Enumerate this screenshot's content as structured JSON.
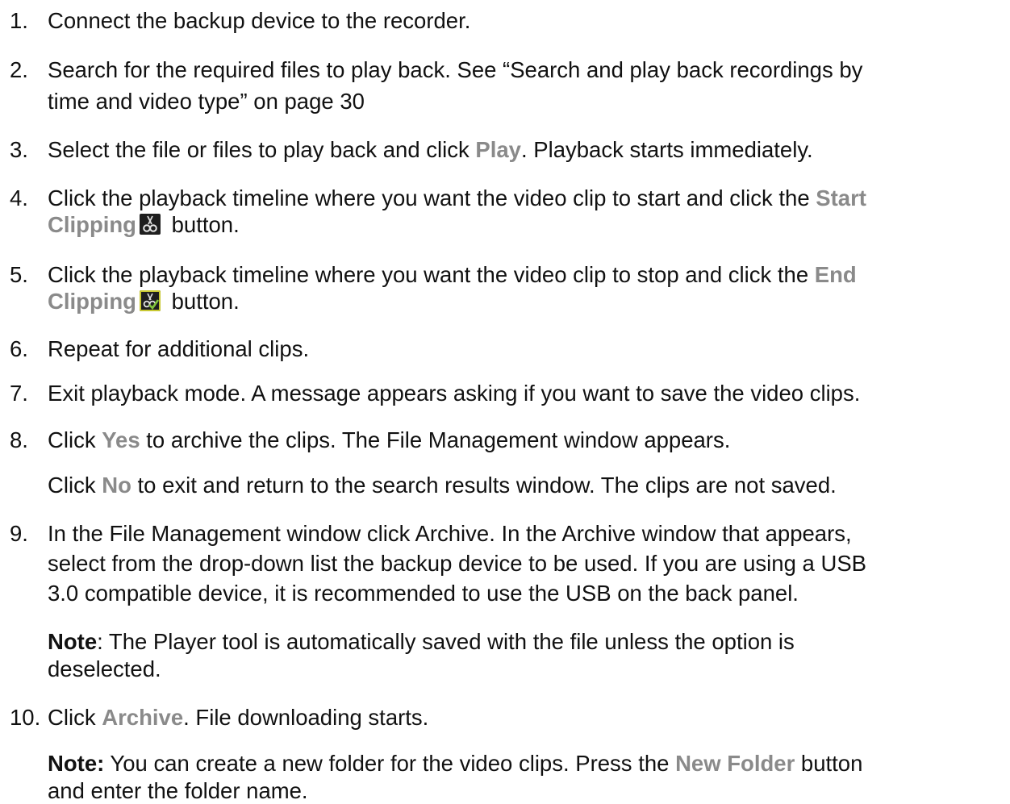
{
  "steps": [
    {
      "num": "1.",
      "text": "Connect the backup device to the recorder."
    },
    {
      "num": "2.",
      "line1": "Search for the required files to play back. See “Search and play back recordings by",
      "line2": "time and video type” on page 30"
    },
    {
      "num": "3.",
      "pre": "Select the file or files to play back and click ",
      "hl": "Play",
      "post": ". Playback starts immediately."
    },
    {
      "num": "4.",
      "line1_pre": "Click the playback timeline where you want the video clip to start and click the ",
      "line1_hl": "Start",
      "line2_hl": "Clipping",
      "line2_post": " button."
    },
    {
      "num": "5.",
      "line1_pre": "Click the playback timeline where you want the video clip to stop and click the ",
      "line1_hl": "End",
      "line2_hl": "Clipping",
      "line2_post": " button."
    },
    {
      "num": "6.",
      "text": "Repeat for additional clips."
    },
    {
      "num": "7.",
      "text": "Exit playback mode. A message appears asking if you want to save the video clips."
    },
    {
      "num": "8.",
      "pre": "Click ",
      "hl": "Yes",
      "post": " to archive the clips. The File Management window appears.",
      "sub_pre": "Click ",
      "sub_hl": "No",
      "sub_post": " to exit and return to the search results window. The clips are not saved."
    },
    {
      "num": "9.",
      "line1": "In the File Management window click Archive.  In the Archive window that appears,",
      "line2": "select from the drop-down list the backup device to be used. If you are using a USB",
      "line3": "3.0 compatible device, it is recommended to use the USB on the back panel.",
      "note_label": "Note",
      "note_line1": ": The Player tool is automatically saved with the file unless the option is",
      "note_line2": "deselected."
    },
    {
      "num": "10.",
      "pre": "Click ",
      "hl": "Archive",
      "post": ". File downloading starts.",
      "note_label": "Note:",
      "note_pre": " You can create a new folder for the video clips. Press the ",
      "note_hl": "New Folder",
      "note_post": " button",
      "note_line2": "and enter the folder name."
    }
  ],
  "icons": {
    "start_clipping": "scissors-icon",
    "end_clipping": "scissors-check-icon",
    "colors": {
      "text": "#111111",
      "highlight": "#8a8a8a",
      "icon_bg": "#1e1e1e",
      "icon_border": "#c8c832",
      "check": "#7fc43a"
    }
  }
}
